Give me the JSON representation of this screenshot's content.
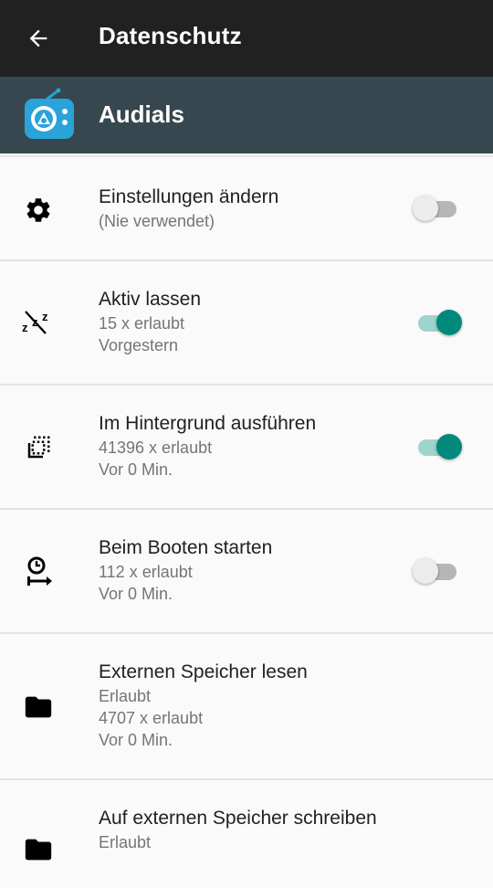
{
  "toolbar": {
    "title": "Datenschutz",
    "back_icon": "arrow-back-icon"
  },
  "app": {
    "name": "Audials",
    "icon": "audials-radio-icon",
    "color": "#29a3d8"
  },
  "colors": {
    "toolbar": "#212121",
    "appbar": "#37474f",
    "toggle_on": "#00897b"
  },
  "permissions": [
    {
      "icon": "gear-icon",
      "label": "Einstellungen ändern",
      "lines": [
        "(Nie verwendet)"
      ],
      "enabled": false
    },
    {
      "icon": "sleep-zzz-icon",
      "label": "Aktiv lassen",
      "lines": [
        "15 x erlaubt",
        "Vorgestern"
      ],
      "enabled": true
    },
    {
      "icon": "background-run-icon",
      "label": "Im Hintergrund ausführen",
      "lines": [
        "41396 x erlaubt",
        "Vor 0 Min."
      ],
      "enabled": true
    },
    {
      "icon": "boot-clock-icon",
      "label": "Beim Booten starten",
      "lines": [
        "112 x erlaubt",
        "Vor 0 Min."
      ],
      "enabled": false
    },
    {
      "icon": "folder-icon",
      "label": "Externen Speicher lesen",
      "lines": [
        "Erlaubt",
        "4707 x erlaubt",
        "Vor 0 Min."
      ],
      "enabled": null
    },
    {
      "icon": "folder-icon",
      "label": "Auf externen Speicher schreiben",
      "lines": [
        "Erlaubt"
      ],
      "enabled": null
    }
  ]
}
